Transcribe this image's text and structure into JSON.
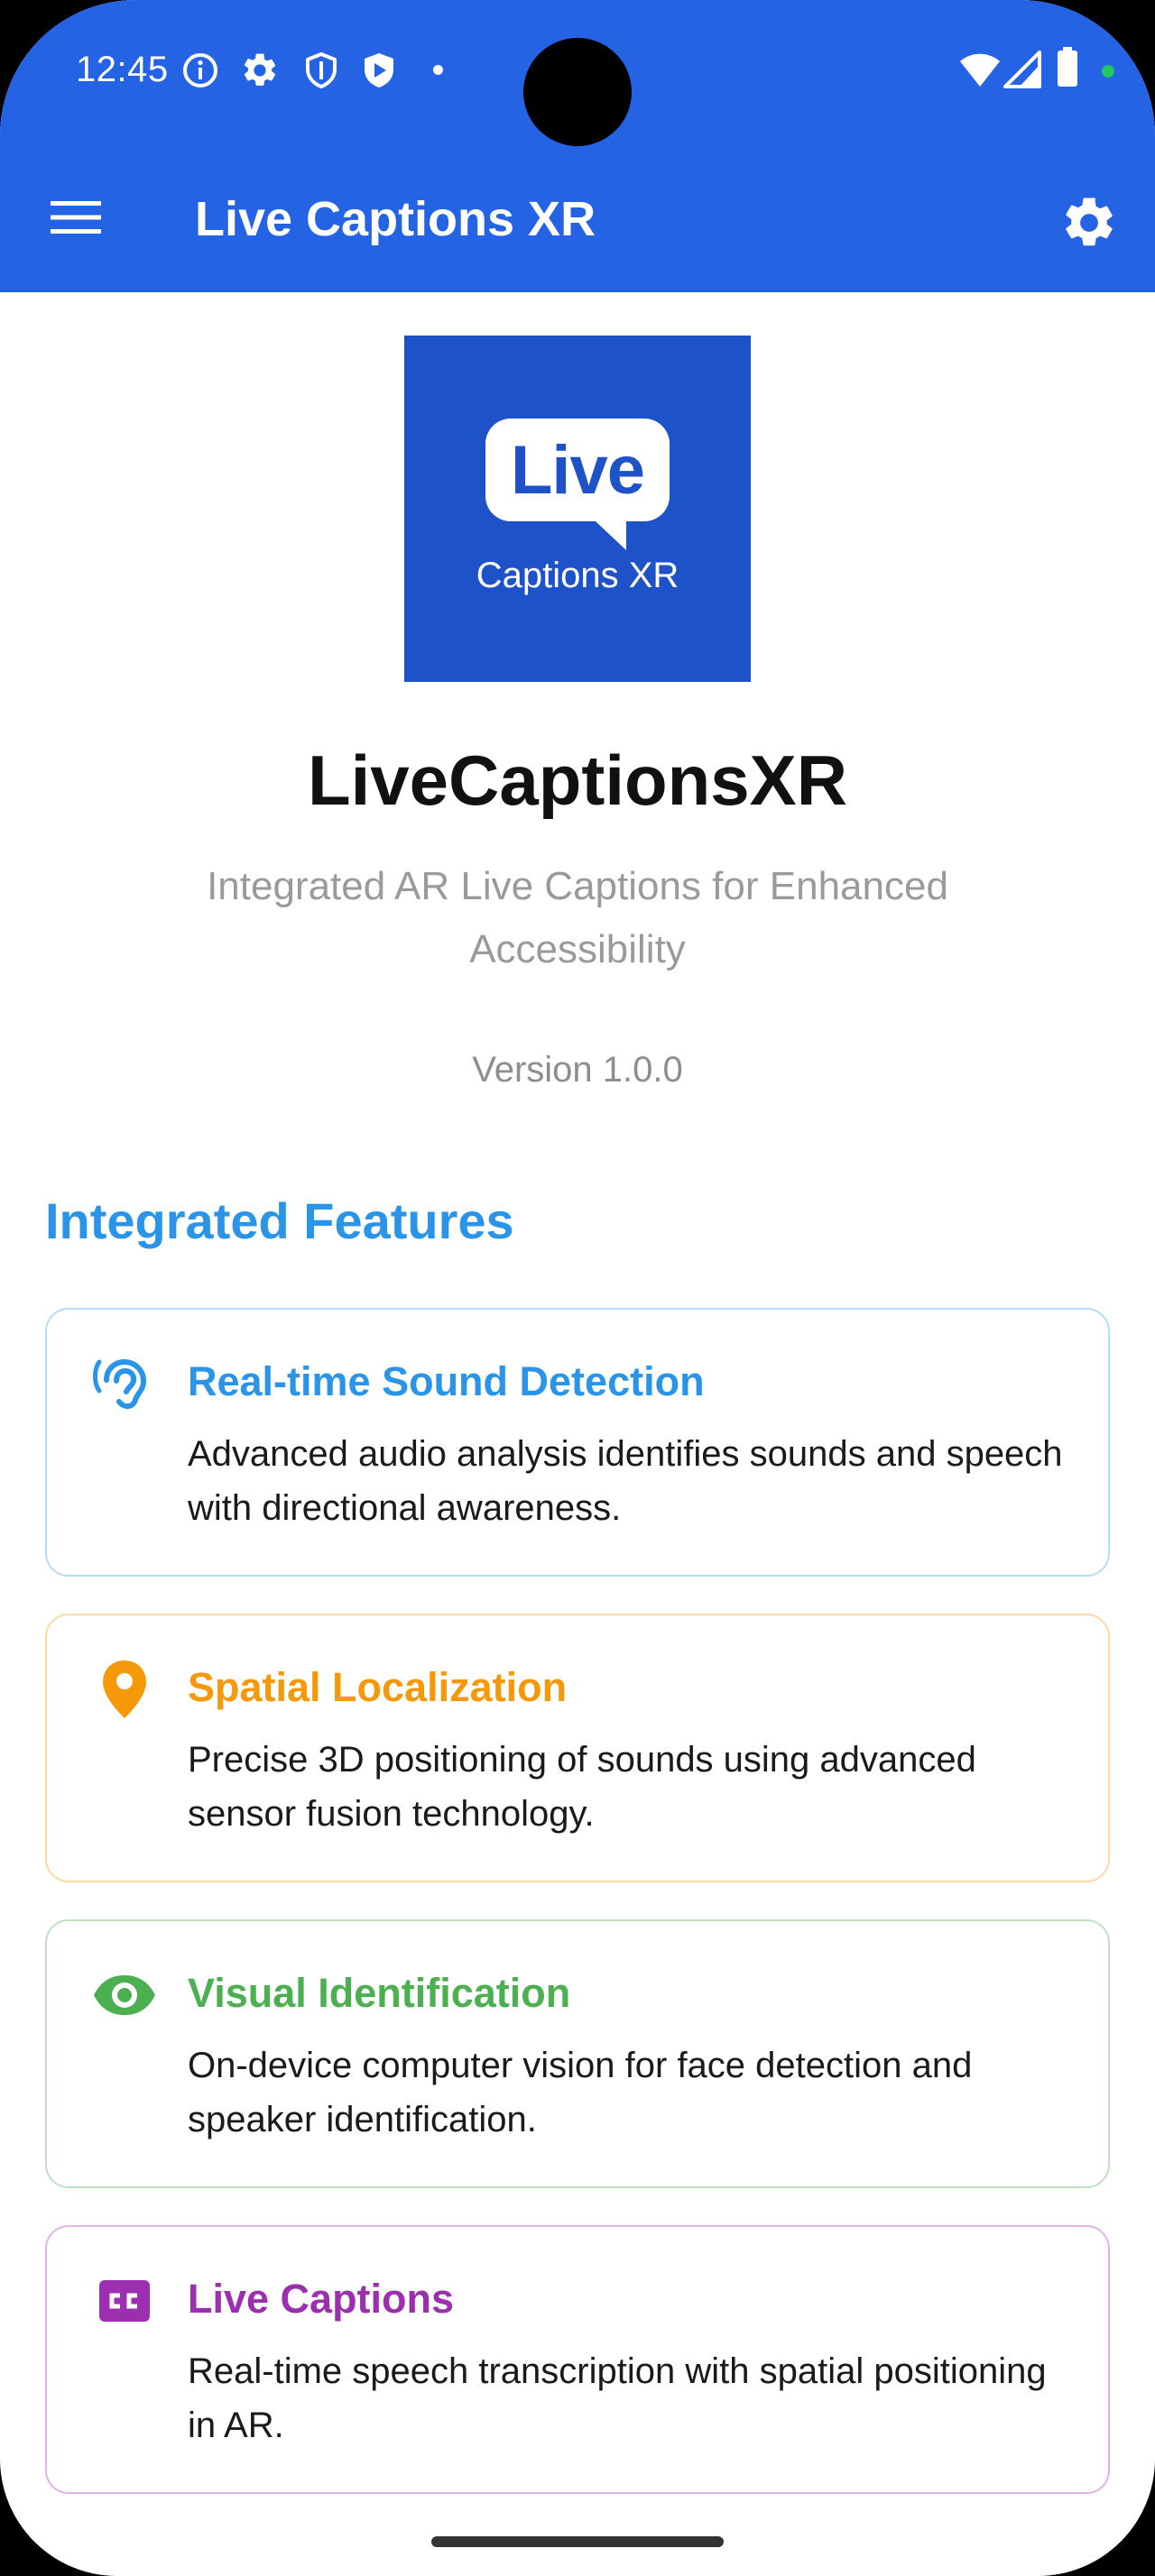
{
  "status_bar": {
    "time": "12:45",
    "icons": [
      "info-icon",
      "gear-icon",
      "shield-icon",
      "play-shield-icon",
      "wifi-icon",
      "signal-icon",
      "battery-icon"
    ]
  },
  "app_bar": {
    "title": "Live Captions XR",
    "menu_icon": "hamburger-menu-icon",
    "settings_icon": "gear-icon",
    "color": "#2563e5"
  },
  "logo": {
    "word": "Live",
    "caption": "Captions XR",
    "color": "#1e52c8"
  },
  "header": {
    "app_name": "LiveCaptionsXR",
    "tagline": "Integrated AR Live Captions for Enhanced Accessibility",
    "version": "Version 1.0.0"
  },
  "features_section": {
    "title": "Integrated Features",
    "title_color": "#2a95e8",
    "items": [
      {
        "title": "Real-time Sound Detection",
        "description": "Advanced audio analysis identifies sounds and speech with directional awareness.",
        "icon": "ear-icon",
        "color": "#2a95e8"
      },
      {
        "title": "Spatial Localization",
        "description": "Precise 3D positioning of sounds using advanced sensor fusion technology.",
        "icon": "location-pin-icon",
        "color": "#f5990b"
      },
      {
        "title": "Visual Identification",
        "description": "On-device computer vision for face detection and speaker identification.",
        "icon": "eye-icon",
        "color": "#4caf50"
      },
      {
        "title": "Live Captions",
        "description": "Real-time speech transcription with spatial positioning in AR.",
        "icon": "closed-caption-icon",
        "color": "#9c2fb0"
      }
    ]
  }
}
